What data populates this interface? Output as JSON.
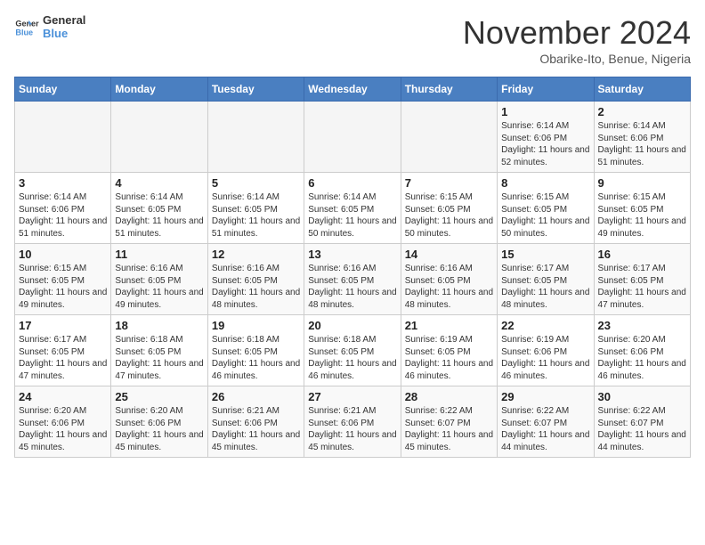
{
  "header": {
    "logo_general": "General",
    "logo_blue": "Blue",
    "month_title": "November 2024",
    "location": "Obarike-Ito, Benue, Nigeria"
  },
  "weekdays": [
    "Sunday",
    "Monday",
    "Tuesday",
    "Wednesday",
    "Thursday",
    "Friday",
    "Saturday"
  ],
  "weeks": [
    [
      {
        "day": "",
        "info": ""
      },
      {
        "day": "",
        "info": ""
      },
      {
        "day": "",
        "info": ""
      },
      {
        "day": "",
        "info": ""
      },
      {
        "day": "",
        "info": ""
      },
      {
        "day": "1",
        "info": "Sunrise: 6:14 AM\nSunset: 6:06 PM\nDaylight: 11 hours and 52 minutes."
      },
      {
        "day": "2",
        "info": "Sunrise: 6:14 AM\nSunset: 6:06 PM\nDaylight: 11 hours and 51 minutes."
      }
    ],
    [
      {
        "day": "3",
        "info": "Sunrise: 6:14 AM\nSunset: 6:06 PM\nDaylight: 11 hours and 51 minutes."
      },
      {
        "day": "4",
        "info": "Sunrise: 6:14 AM\nSunset: 6:05 PM\nDaylight: 11 hours and 51 minutes."
      },
      {
        "day": "5",
        "info": "Sunrise: 6:14 AM\nSunset: 6:05 PM\nDaylight: 11 hours and 51 minutes."
      },
      {
        "day": "6",
        "info": "Sunrise: 6:14 AM\nSunset: 6:05 PM\nDaylight: 11 hours and 50 minutes."
      },
      {
        "day": "7",
        "info": "Sunrise: 6:15 AM\nSunset: 6:05 PM\nDaylight: 11 hours and 50 minutes."
      },
      {
        "day": "8",
        "info": "Sunrise: 6:15 AM\nSunset: 6:05 PM\nDaylight: 11 hours and 50 minutes."
      },
      {
        "day": "9",
        "info": "Sunrise: 6:15 AM\nSunset: 6:05 PM\nDaylight: 11 hours and 49 minutes."
      }
    ],
    [
      {
        "day": "10",
        "info": "Sunrise: 6:15 AM\nSunset: 6:05 PM\nDaylight: 11 hours and 49 minutes."
      },
      {
        "day": "11",
        "info": "Sunrise: 6:16 AM\nSunset: 6:05 PM\nDaylight: 11 hours and 49 minutes."
      },
      {
        "day": "12",
        "info": "Sunrise: 6:16 AM\nSunset: 6:05 PM\nDaylight: 11 hours and 48 minutes."
      },
      {
        "day": "13",
        "info": "Sunrise: 6:16 AM\nSunset: 6:05 PM\nDaylight: 11 hours and 48 minutes."
      },
      {
        "day": "14",
        "info": "Sunrise: 6:16 AM\nSunset: 6:05 PM\nDaylight: 11 hours and 48 minutes."
      },
      {
        "day": "15",
        "info": "Sunrise: 6:17 AM\nSunset: 6:05 PM\nDaylight: 11 hours and 48 minutes."
      },
      {
        "day": "16",
        "info": "Sunrise: 6:17 AM\nSunset: 6:05 PM\nDaylight: 11 hours and 47 minutes."
      }
    ],
    [
      {
        "day": "17",
        "info": "Sunrise: 6:17 AM\nSunset: 6:05 PM\nDaylight: 11 hours and 47 minutes."
      },
      {
        "day": "18",
        "info": "Sunrise: 6:18 AM\nSunset: 6:05 PM\nDaylight: 11 hours and 47 minutes."
      },
      {
        "day": "19",
        "info": "Sunrise: 6:18 AM\nSunset: 6:05 PM\nDaylight: 11 hours and 46 minutes."
      },
      {
        "day": "20",
        "info": "Sunrise: 6:18 AM\nSunset: 6:05 PM\nDaylight: 11 hours and 46 minutes."
      },
      {
        "day": "21",
        "info": "Sunrise: 6:19 AM\nSunset: 6:05 PM\nDaylight: 11 hours and 46 minutes."
      },
      {
        "day": "22",
        "info": "Sunrise: 6:19 AM\nSunset: 6:06 PM\nDaylight: 11 hours and 46 minutes."
      },
      {
        "day": "23",
        "info": "Sunrise: 6:20 AM\nSunset: 6:06 PM\nDaylight: 11 hours and 46 minutes."
      }
    ],
    [
      {
        "day": "24",
        "info": "Sunrise: 6:20 AM\nSunset: 6:06 PM\nDaylight: 11 hours and 45 minutes."
      },
      {
        "day": "25",
        "info": "Sunrise: 6:20 AM\nSunset: 6:06 PM\nDaylight: 11 hours and 45 minutes."
      },
      {
        "day": "26",
        "info": "Sunrise: 6:21 AM\nSunset: 6:06 PM\nDaylight: 11 hours and 45 minutes."
      },
      {
        "day": "27",
        "info": "Sunrise: 6:21 AM\nSunset: 6:06 PM\nDaylight: 11 hours and 45 minutes."
      },
      {
        "day": "28",
        "info": "Sunrise: 6:22 AM\nSunset: 6:07 PM\nDaylight: 11 hours and 45 minutes."
      },
      {
        "day": "29",
        "info": "Sunrise: 6:22 AM\nSunset: 6:07 PM\nDaylight: 11 hours and 44 minutes."
      },
      {
        "day": "30",
        "info": "Sunrise: 6:22 AM\nSunset: 6:07 PM\nDaylight: 11 hours and 44 minutes."
      }
    ]
  ]
}
